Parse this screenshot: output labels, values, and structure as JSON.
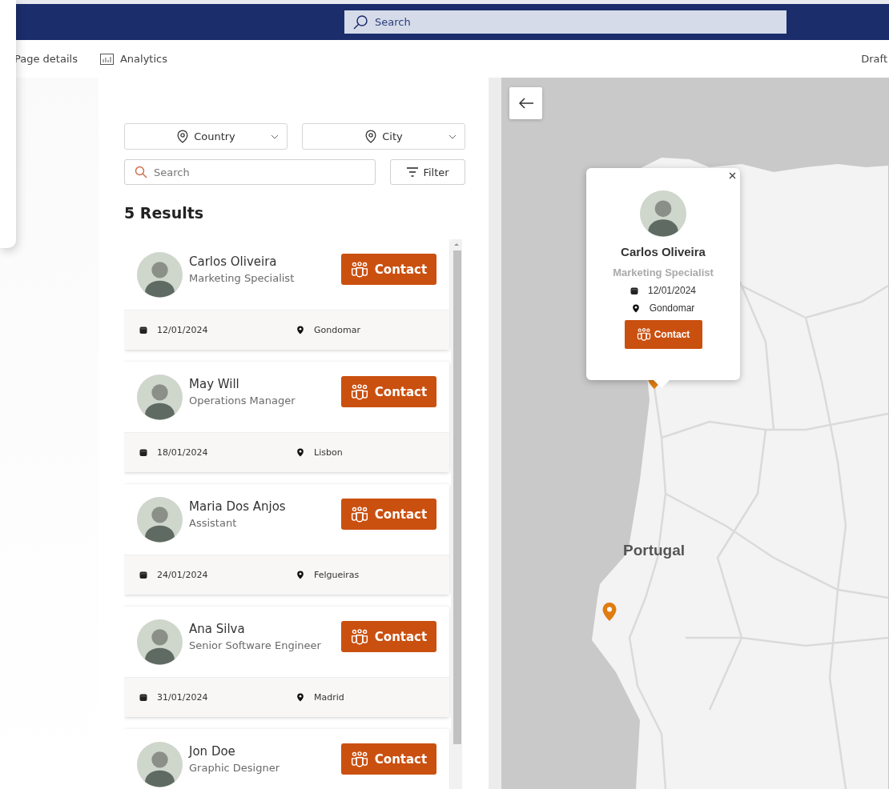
{
  "header": {
    "search_placeholder": "Search"
  },
  "toolbar": {
    "page_details": "Page details",
    "analytics": "Analytics",
    "status": "Draft"
  },
  "filters": {
    "country": "Country",
    "city": "City",
    "search_placeholder": "Search",
    "filter_button": "Filter"
  },
  "results_heading": "5 Results",
  "people": [
    {
      "name": "Carlos Oliveira",
      "role": "Marketing Specialist",
      "date": "12/01/2024",
      "city": "Gondomar",
      "action": "Contact"
    },
    {
      "name": "May Will",
      "role": "Operations Manager",
      "date": "18/01/2024",
      "city": "Lisbon",
      "action": "Contact"
    },
    {
      "name": "Maria Dos Anjos",
      "role": "Assistant",
      "date": "24/01/2024",
      "city": "Felgueiras",
      "action": "Contact"
    },
    {
      "name": "Ana Silva",
      "role": "Senior Software Engineer",
      "date": "31/01/2024",
      "city": "Madrid",
      "action": "Contact"
    },
    {
      "name": "Jon Doe",
      "role": "Graphic Designer",
      "action": "Contact"
    }
  ],
  "map": {
    "country_label": "Portugal",
    "popup": {
      "name": "Carlos Oliveira",
      "role": "Marketing Specialist",
      "date": "12/01/2024",
      "city": "Gondomar",
      "action": "Contact"
    }
  }
}
